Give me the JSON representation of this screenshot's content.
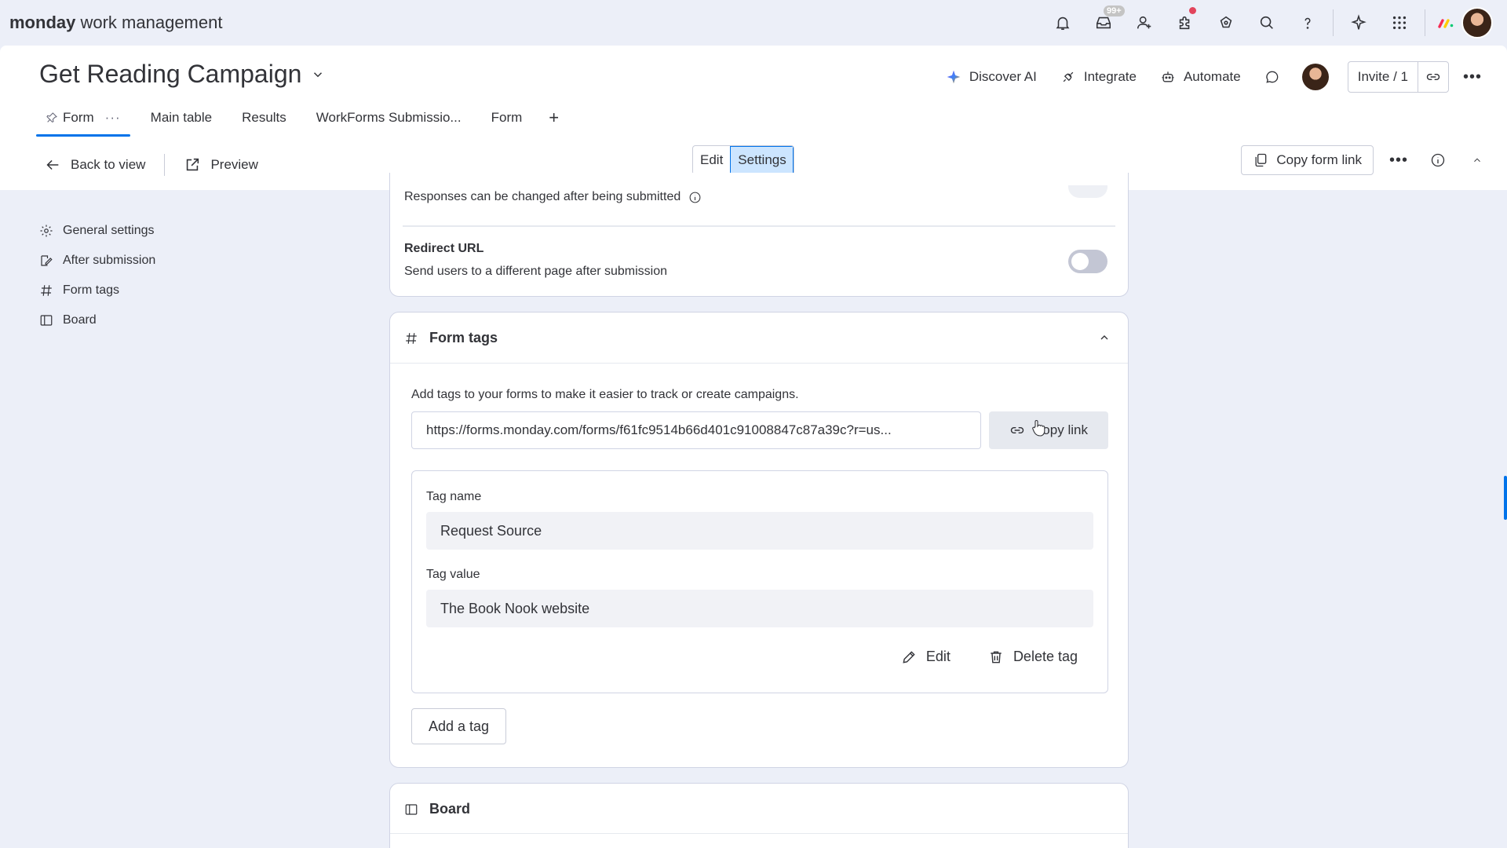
{
  "brand": {
    "bold": "monday",
    "rest": "work management"
  },
  "topbar": {
    "inbox_badge": "99+"
  },
  "header": {
    "board_title": "Get Reading Campaign",
    "discover_ai": "Discover AI",
    "integrate": "Integrate",
    "automate": "Automate",
    "invite": "Invite / 1"
  },
  "tabs": [
    {
      "label": "Form"
    },
    {
      "label": "Main table"
    },
    {
      "label": "Results"
    },
    {
      "label": "WorkForms Submissio..."
    },
    {
      "label": "Form"
    }
  ],
  "tab_add": "+",
  "toolbar": {
    "back": "Back to view",
    "preview": "Preview",
    "edit": "Edit",
    "settings": "Settings",
    "copy_form_link": "Copy form link"
  },
  "sidebar": {
    "items": [
      {
        "label": "General settings",
        "icon": "gear-icon"
      },
      {
        "label": "After submission",
        "icon": "edit-note-icon"
      },
      {
        "label": "Form tags",
        "icon": "hash-icon"
      },
      {
        "label": "Board",
        "icon": "board-icon"
      }
    ]
  },
  "responses_card": {
    "responses_text": "Responses can be changed after being submitted",
    "redirect_title": "Redirect URL",
    "redirect_sub": "Send users to a different page after submission",
    "redirect_enabled": false
  },
  "form_tags": {
    "title": "Form tags",
    "description": "Add tags to your forms to make it easier to track or create campaigns.",
    "url": "https://forms.monday.com/forms/f61fc9514b66d401c91008847c87a39c?r=us...",
    "copy_link": "Copy link",
    "tag_name_label": "Tag name",
    "tag_name_value": "Request Source",
    "tag_value_label": "Tag value",
    "tag_value_value": "The Book Nook website",
    "edit": "Edit",
    "delete": "Delete tag",
    "add_tag": "Add a tag"
  },
  "board_card": {
    "title": "Board"
  },
  "colors": {
    "accent": "#0073ea",
    "selected_bg": "#cce5ff",
    "canvas": "#eceff8"
  }
}
